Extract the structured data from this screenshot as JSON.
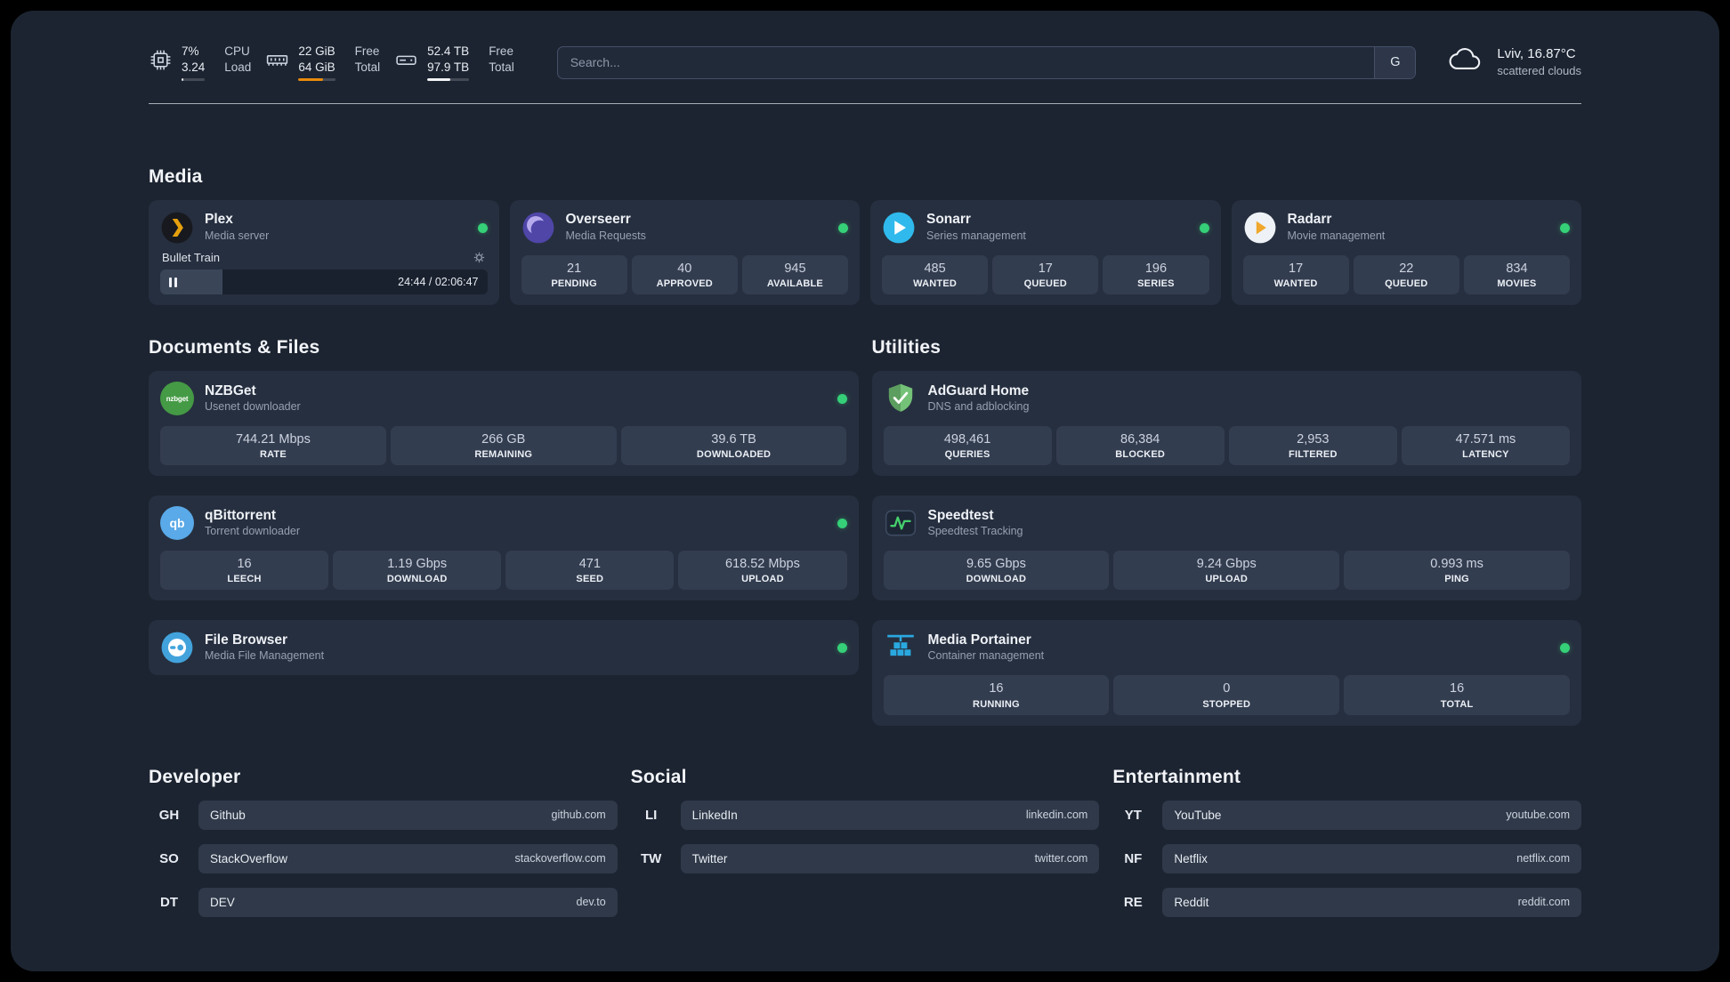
{
  "header": {
    "cpu": {
      "value_top": "7%",
      "value_bottom": "3.24",
      "label_top": "CPU",
      "label_bottom": "Load"
    },
    "memory": {
      "value_top": "22 GiB",
      "value_bottom": "64 GiB",
      "label_top": "Free",
      "label_bottom": "Total"
    },
    "disk": {
      "value_top": "52.4 TB",
      "value_bottom": "97.9 TB",
      "label_top": "Free",
      "label_bottom": "Total"
    },
    "search": {
      "placeholder": "Search...",
      "engine": "G"
    },
    "weather": {
      "location": "Lviv, 16.87°C",
      "condition": "scattered clouds"
    }
  },
  "media": {
    "title": "Media",
    "plex": {
      "name": "Plex",
      "subtitle": "Media server",
      "now_playing": "Bullet Train",
      "time": "24:44 / 02:06:47"
    },
    "overseerr": {
      "name": "Overseerr",
      "subtitle": "Media Requests",
      "stats": [
        {
          "value": "21",
          "label": "PENDING"
        },
        {
          "value": "40",
          "label": "APPROVED"
        },
        {
          "value": "945",
          "label": "AVAILABLE"
        }
      ]
    },
    "sonarr": {
      "name": "Sonarr",
      "subtitle": "Series management",
      "stats": [
        {
          "value": "485",
          "label": "WANTED"
        },
        {
          "value": "17",
          "label": "QUEUED"
        },
        {
          "value": "196",
          "label": "SERIES"
        }
      ]
    },
    "radarr": {
      "name": "Radarr",
      "subtitle": "Movie management",
      "stats": [
        {
          "value": "17",
          "label": "WANTED"
        },
        {
          "value": "22",
          "label": "QUEUED"
        },
        {
          "value": "834",
          "label": "MOVIES"
        }
      ]
    }
  },
  "documents": {
    "title": "Documents & Files",
    "nzbget": {
      "name": "NZBGet",
      "subtitle": "Usenet downloader",
      "stats": [
        {
          "value": "744.21 Mbps",
          "label": "RATE"
        },
        {
          "value": "266 GB",
          "label": "REMAINING"
        },
        {
          "value": "39.6 TB",
          "label": "DOWNLOADED"
        }
      ]
    },
    "qbittorrent": {
      "name": "qBittorrent",
      "subtitle": "Torrent downloader",
      "stats": [
        {
          "value": "16",
          "label": "LEECH"
        },
        {
          "value": "1.19 Gbps",
          "label": "DOWNLOAD"
        },
        {
          "value": "471",
          "label": "SEED"
        },
        {
          "value": "618.52 Mbps",
          "label": "UPLOAD"
        }
      ]
    },
    "filebrowser": {
      "name": "File Browser",
      "subtitle": "Media File Management"
    }
  },
  "utilities": {
    "title": "Utilities",
    "adguard": {
      "name": "AdGuard Home",
      "subtitle": "DNS and adblocking",
      "stats": [
        {
          "value": "498,461",
          "label": "QUERIES"
        },
        {
          "value": "86,384",
          "label": "BLOCKED"
        },
        {
          "value": "2,953",
          "label": "FILTERED"
        },
        {
          "value": "47.571 ms",
          "label": "LATENCY"
        }
      ]
    },
    "speedtest": {
      "name": "Speedtest",
      "subtitle": "Speedtest Tracking",
      "stats": [
        {
          "value": "9.65 Gbps",
          "label": "DOWNLOAD"
        },
        {
          "value": "9.24 Gbps",
          "label": "UPLOAD"
        },
        {
          "value": "0.993 ms",
          "label": "PING"
        }
      ]
    },
    "portainer": {
      "name": "Media Portainer",
      "subtitle": "Container management",
      "stats": [
        {
          "value": "16",
          "label": "RUNNING"
        },
        {
          "value": "0",
          "label": "STOPPED"
        },
        {
          "value": "16",
          "label": "TOTAL"
        }
      ]
    }
  },
  "bookmarks": [
    {
      "title": "Developer",
      "links": [
        {
          "abbr": "GH",
          "name": "Github",
          "url": "github.com"
        },
        {
          "abbr": "SO",
          "name": "StackOverflow",
          "url": "stackoverflow.com"
        },
        {
          "abbr": "DT",
          "name": "DEV",
          "url": "dev.to"
        }
      ]
    },
    {
      "title": "Social",
      "links": [
        {
          "abbr": "LI",
          "name": "LinkedIn",
          "url": "linkedin.com"
        },
        {
          "abbr": "TW",
          "name": "Twitter",
          "url": "twitter.com"
        }
      ]
    },
    {
      "title": "Entertainment",
      "links": [
        {
          "abbr": "YT",
          "name": "YouTube",
          "url": "youtube.com"
        },
        {
          "abbr": "NF",
          "name": "Netflix",
          "url": "netflix.com"
        },
        {
          "abbr": "RE",
          "name": "Reddit",
          "url": "reddit.com"
        }
      ]
    }
  ],
  "colors": {
    "status_online": "#35d077",
    "memory_bar": "#e8890c",
    "plex_accent": "#e5a00d"
  }
}
